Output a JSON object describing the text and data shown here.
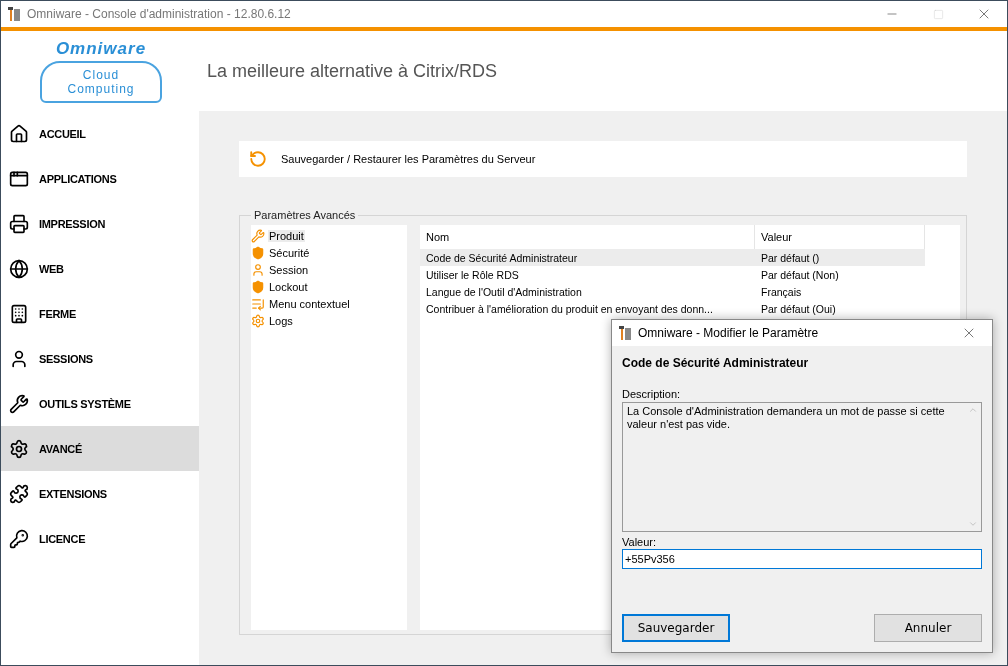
{
  "window": {
    "title": "Omniware - Console d'administration - 12.80.6.12"
  },
  "logo": {
    "brand": "Omniware",
    "line_1": "Cloud",
    "line_2": "Computing"
  },
  "tagline": "La meilleure alternative à Citrix/RDS",
  "sidebar": {
    "items": [
      {
        "label": "ACCUEIL",
        "selected": false
      },
      {
        "label": "APPLICATIONS",
        "selected": false
      },
      {
        "label": "IMPRESSION",
        "selected": false
      },
      {
        "label": "WEB",
        "selected": false
      },
      {
        "label": "FERME",
        "selected": false
      },
      {
        "label": "SESSIONS",
        "selected": false
      },
      {
        "label": "OUTILS SYSTÈME",
        "selected": false
      },
      {
        "label": "AVANCÉ",
        "selected": true
      },
      {
        "label": "EXTENSIONS",
        "selected": false
      },
      {
        "label": "LICENCE",
        "selected": false
      }
    ]
  },
  "save_restore": {
    "label": "Sauvegarder / Restaurer les Paramètres du Serveur"
  },
  "advanced": {
    "title": "Paramètres Avancés",
    "categories": [
      {
        "label": "Produit",
        "selected": true
      },
      {
        "label": "Sécurité",
        "selected": false
      },
      {
        "label": "Session",
        "selected": false
      },
      {
        "label": "Lockout",
        "selected": false
      },
      {
        "label": "Menu contextuel",
        "selected": false
      },
      {
        "label": "Logs",
        "selected": false
      }
    ],
    "table": {
      "columns": [
        "Nom",
        "Valeur"
      ],
      "rows": [
        {
          "name": "Code de Sécurité Administrateur",
          "value": "Par défaut ()",
          "selected": true
        },
        {
          "name": "Utiliser le Rôle RDS",
          "value": "Par défaut (Non)",
          "selected": false
        },
        {
          "name": "Langue de l'Outil d'Administration",
          "value": "Français",
          "selected": false
        },
        {
          "name": "Contribuer à l'amélioration du produit en envoyant des donn...",
          "value": "Par défaut (Oui)",
          "selected": false
        }
      ]
    }
  },
  "dialog": {
    "title": "Omniware - Modifier le Paramètre",
    "heading": "Code de Sécurité Administrateur",
    "description_label": "Description:",
    "description": "La Console d'Administration demandera un mot de passe si cette valeur n'est pas vide.",
    "value_label": "Valeur:",
    "value": "+55Pv356",
    "buttons": [
      {
        "label": "Sauvegarder",
        "default": true
      },
      {
        "label": "Annuler",
        "default": false
      }
    ]
  }
}
